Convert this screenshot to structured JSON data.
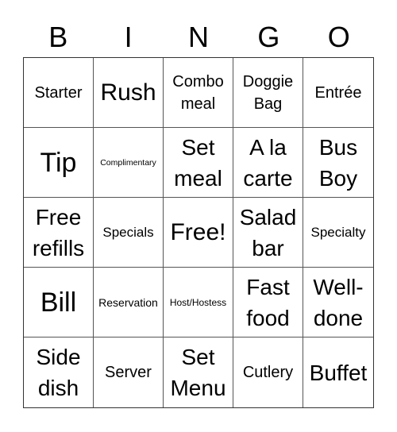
{
  "header": {
    "letters": [
      "B",
      "I",
      "N",
      "G",
      "O"
    ]
  },
  "cells": [
    {
      "text": "Starter",
      "size": "fs-s"
    },
    {
      "text": "Rush",
      "size": "fs-l"
    },
    {
      "text": "Combo meal",
      "size": "fs-s"
    },
    {
      "text": "Doggie Bag",
      "size": "fs-s"
    },
    {
      "text": "Entrée",
      "size": "fs-s"
    },
    {
      "text": "Tip",
      "size": "fs-xl"
    },
    {
      "text": "Complimentary",
      "size": "fs-micro"
    },
    {
      "text": "Set meal",
      "size": "fs-m2"
    },
    {
      "text": "A la carte",
      "size": "fs-m2"
    },
    {
      "text": "Bus Boy",
      "size": "fs-m2"
    },
    {
      "text": "Free refills",
      "size": "fs-m2"
    },
    {
      "text": "Specials",
      "size": "fs-xs"
    },
    {
      "text": "Free!",
      "size": "fs-l"
    },
    {
      "text": "Salad bar",
      "size": "fs-m2"
    },
    {
      "text": "Specialty",
      "size": "fs-xs"
    },
    {
      "text": "Bill",
      "size": "fs-xl"
    },
    {
      "text": "Reservation",
      "size": "fs-xxs"
    },
    {
      "text": "Host/Hostess",
      "size": "fs-tiny"
    },
    {
      "text": "Fast food",
      "size": "fs-m2"
    },
    {
      "text": "Well-done",
      "size": "fs-m2"
    },
    {
      "text": "Side dish",
      "size": "fs-m2"
    },
    {
      "text": "Server",
      "size": "fs-s"
    },
    {
      "text": "Set Menu",
      "size": "fs-m2"
    },
    {
      "text": "Cutlery",
      "size": "fs-s"
    },
    {
      "text": "Buffet",
      "size": "fs-m2"
    }
  ]
}
